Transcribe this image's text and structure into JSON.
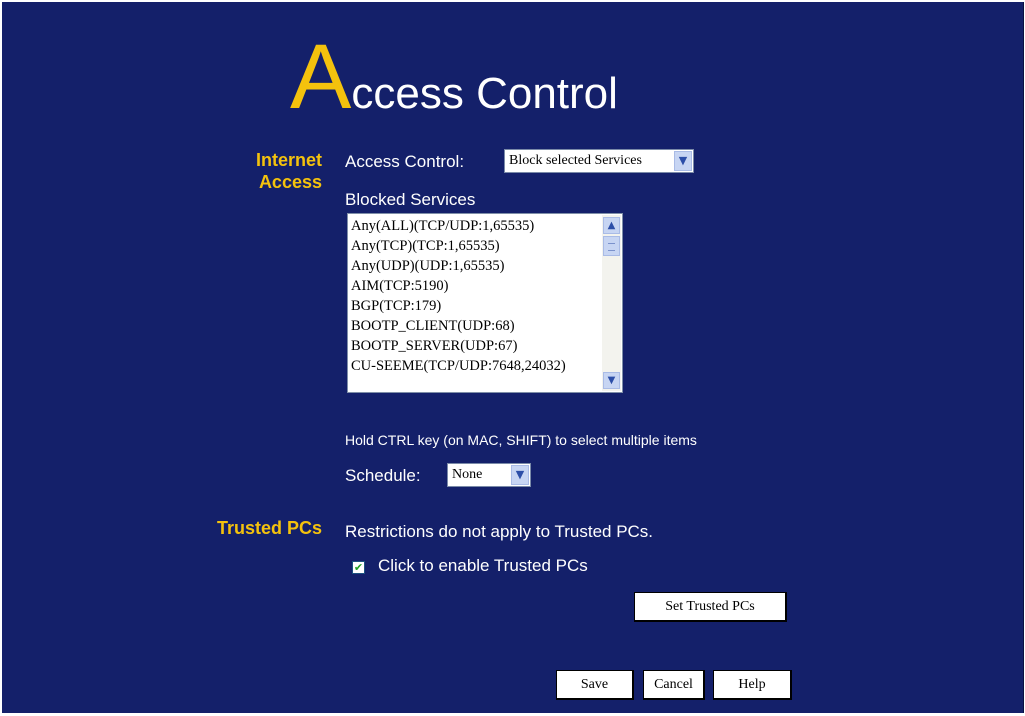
{
  "page": {
    "title_initial": "A",
    "title_rest": "ccess Control"
  },
  "internet_access": {
    "section_line1": "Internet",
    "section_line2": "Access",
    "access_control_label": "Access Control:",
    "access_control_value": "Block selected Services",
    "blocked_services_label": "Blocked Services",
    "blocked_services": [
      "Any(ALL)(TCP/UDP:1,65535)",
      "Any(TCP)(TCP:1,65535)",
      "Any(UDP)(UDP:1,65535)",
      "AIM(TCP:5190)",
      "BGP(TCP:179)",
      "BOOTP_CLIENT(UDP:68)",
      "BOOTP_SERVER(UDP:67)",
      "CU-SEEME(TCP/UDP:7648,24032)"
    ],
    "hint": "Hold CTRL key (on MAC, SHIFT) to select multiple items",
    "schedule_label": "Schedule:",
    "schedule_value": "None"
  },
  "trusted_pcs": {
    "section_label": "Trusted PCs",
    "description": "Restrictions do not apply to Trusted PCs.",
    "checkbox_label": "Click to enable Trusted PCs",
    "checkbox_checked": true,
    "set_button": "Set Trusted PCs"
  },
  "actions": {
    "save": "Save",
    "cancel": "Cancel",
    "help": "Help"
  },
  "icons": {
    "dropdown": "chevron-down-icon",
    "scroll_up": "scroll-up-icon",
    "scroll_down": "scroll-down-icon",
    "check": "check-icon"
  },
  "colors": {
    "background": "#14206a",
    "accent": "#f4c20d",
    "text": "#ffffff"
  }
}
